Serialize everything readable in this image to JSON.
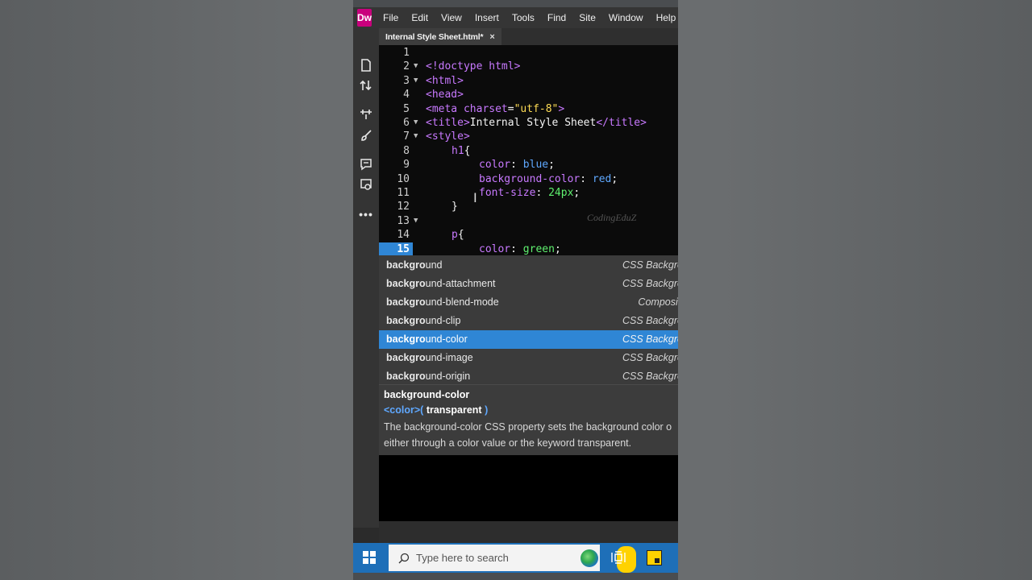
{
  "app": {
    "logo": "Dw"
  },
  "menu": [
    "File",
    "Edit",
    "View",
    "Insert",
    "Tools",
    "Find",
    "Site",
    "Window",
    "Help"
  ],
  "tab": {
    "title": "Internal Style Sheet.html*",
    "close": "×"
  },
  "editor": {
    "current_line": 15,
    "lines": [
      {
        "n": "1",
        "fold": ""
      },
      {
        "n": "2",
        "fold": "▼"
      },
      {
        "n": "3",
        "fold": "▼"
      },
      {
        "n": "4",
        "fold": ""
      },
      {
        "n": "5",
        "fold": ""
      },
      {
        "n": "6",
        "fold": "▼"
      },
      {
        "n": "7",
        "fold": "▼"
      },
      {
        "n": "8",
        "fold": ""
      },
      {
        "n": "9",
        "fold": ""
      },
      {
        "n": "10",
        "fold": ""
      },
      {
        "n": "11",
        "fold": ""
      },
      {
        "n": "12",
        "fold": ""
      },
      {
        "n": "13",
        "fold": "▼"
      },
      {
        "n": "14",
        "fold": ""
      },
      {
        "n": "15",
        "fold": ""
      }
    ],
    "code": {
      "l1": "<!doctype html>",
      "l2": "<html>",
      "l3": "<head>",
      "l4_tag": "<meta ",
      "l4_attr": "charset",
      "l4_eq": "=",
      "l4_str": "\"utf-8\"",
      "l4_end": ">",
      "l5_open": "<title>",
      "l5_text": "Internal Style Sheet",
      "l5_close": "</title>",
      "l6": "<style>",
      "l7_sel": "h1",
      "l7_brace": "{",
      "l8_prop": "color",
      "l8_colon": ": ",
      "l8_val": "blue",
      "l8_end": ";",
      "l9_prop": "background-color",
      "l9_colon": ": ",
      "l9_val": "red",
      "l9_end": ";",
      "l10_prop": "font-size",
      "l10_colon": ": ",
      "l10_val": "24px",
      "l10_end": ";",
      "l11": "}",
      "l13_sel": "p",
      "l13_brace": "{",
      "l14_prop": "color",
      "l14_colon": ": ",
      "l14_val": "green",
      "l14_end": ";",
      "l15_typed": "backgro"
    },
    "watermark": "CodingEduZ"
  },
  "code_hints": {
    "typed": "backgro",
    "items": [
      {
        "match": "backgro",
        "rest": "und",
        "category": "CSS Backgro",
        "selected": false
      },
      {
        "match": "backgro",
        "rest": "und-attachment",
        "category": "CSS Backgro",
        "selected": false
      },
      {
        "match": "backgro",
        "rest": "und-blend-mode",
        "category": "Compositi",
        "selected": false
      },
      {
        "match": "backgro",
        "rest": "und-clip",
        "category": "CSS Backgro",
        "selected": false
      },
      {
        "match": "backgro",
        "rest": "und-color",
        "category": "CSS Backgro",
        "selected": true
      },
      {
        "match": "backgro",
        "rest": "und-image",
        "category": "CSS Backgro",
        "selected": false
      },
      {
        "match": "backgro",
        "rest": "und-origin",
        "category": "CSS Backgro",
        "selected": false
      }
    ]
  },
  "hint_doc": {
    "title": "background-color",
    "sig_type": "<color>",
    "sig_open": "( ",
    "sig_kw": "transparent",
    "sig_close": " )",
    "desc_line1": "The background-color CSS property sets the background color o",
    "desc_line2": "either through a color value or the keyword transparent."
  },
  "taskbar": {
    "search_placeholder": "Type here to search"
  },
  "colors": {
    "accent": "#2f86d5",
    "dw_brand": "#c9007d",
    "taskbar": "#1e6fb8"
  }
}
